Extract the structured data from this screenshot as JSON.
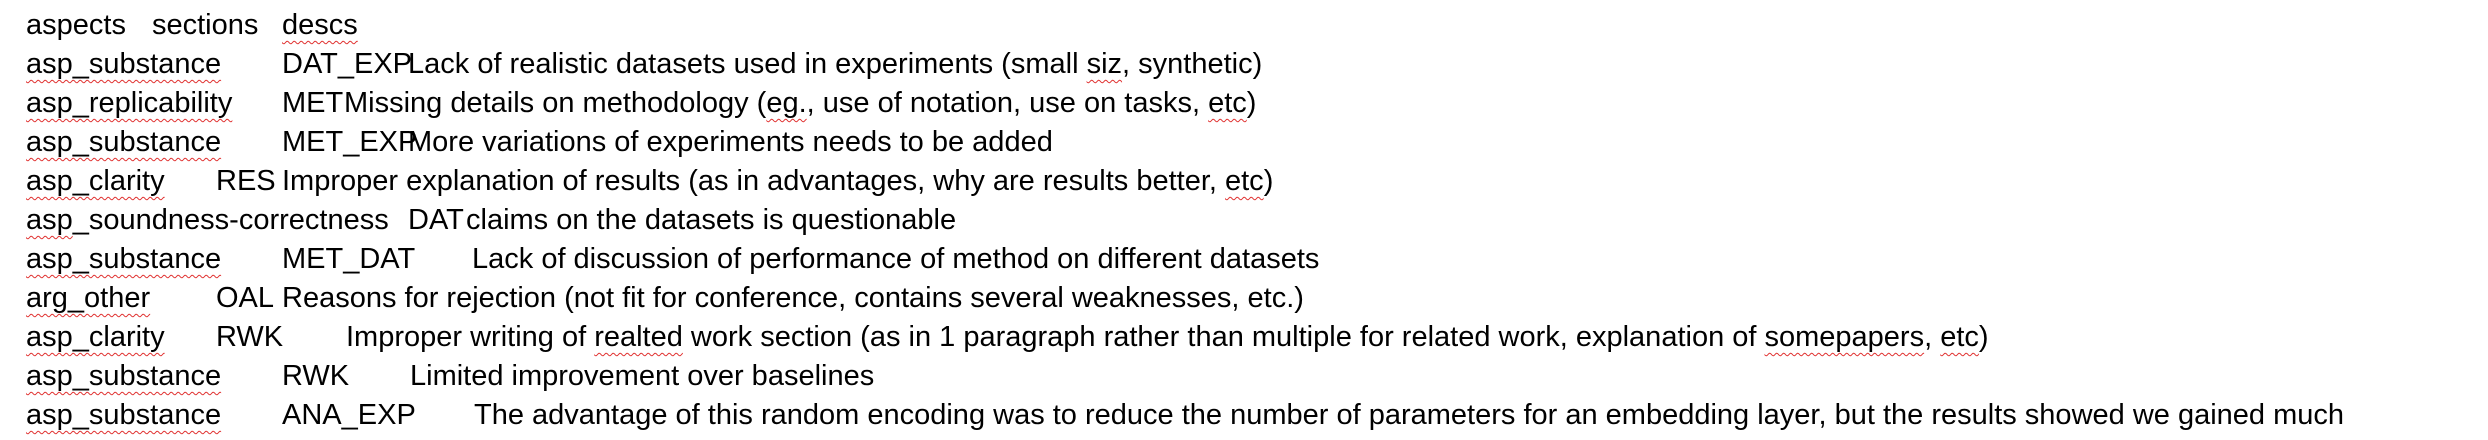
{
  "document": {
    "header": {
      "col1": "aspects",
      "col2": "sections",
      "col3": "descs"
    },
    "rows": [
      {
        "aspect": "asp_substance",
        "section": "DAT_EXP",
        "desc_a": "Lack of realistic datasets used in experiments (small ",
        "desc_b": "siz",
        "desc_c": ", synthetic)"
      },
      {
        "aspect": "asp_replicability",
        "section": "MET",
        "desc_a": "Missing details on methodology (",
        "desc_b": "eg.",
        "desc_c": ", use of notation, use on tasks, ",
        "desc_d": "etc",
        "desc_e": ")"
      },
      {
        "aspect": "asp_substance",
        "section": "MET_EXP",
        "desc": "More variations of experiments needs to be added"
      },
      {
        "aspect": "asp_clarity",
        "section": "RES",
        "desc_a": "Improper explanation of results (as in advantages, why are results better, ",
        "desc_b": "etc",
        "desc_c": ")"
      },
      {
        "aspect_a": "asp",
        "aspect_b": "_soundness-correctness",
        "section": "DAT",
        "desc": "claims on the datasets is questionable"
      },
      {
        "aspect": "asp_substance",
        "section": "MET_DAT",
        "desc": "Lack of discussion of performance of method on different datasets"
      },
      {
        "aspect": "arg_other",
        "section": "OAL",
        "desc": "Reasons for rejection (not fit for conference, contains several weaknesses, etc.)"
      },
      {
        "aspect": "asp_clarity",
        "section": "RWK",
        "desc_a": "Improper writing of ",
        "desc_b": "realted",
        "desc_c": " work section (as in 1 paragraph rather than multiple for related work, explanation of ",
        "desc_d": "somepapers",
        "desc_e": ", ",
        "desc_f": "etc",
        "desc_g": ")"
      },
      {
        "aspect": "asp_substance",
        "section": "RWK",
        "desc": "Limited improvement over baselines"
      },
      {
        "aspect": "asp_substance",
        "section": "ANA_EXP",
        "desc": "The advantage of this random encoding was to reduce the number of parameters for an embedding layer, but the results showed we gained much"
      }
    ]
  }
}
